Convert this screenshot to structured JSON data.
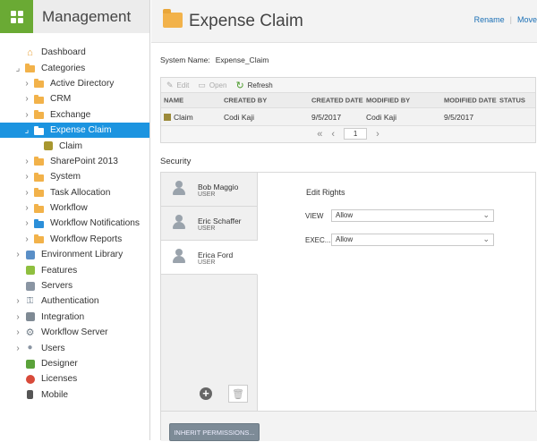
{
  "app": {
    "title": "Management"
  },
  "colors": {
    "accent": "#1c94e0",
    "brand": "#6aaa34",
    "folder": "#f2b24a"
  },
  "sidebar": {
    "items": [
      {
        "label": "Dashboard",
        "icon": "home-icon",
        "level": 0,
        "twist": ""
      },
      {
        "label": "Categories",
        "icon": "folder-icon",
        "level": 0,
        "twist": "expanded"
      },
      {
        "label": "Active Directory",
        "icon": "folder-icon",
        "level": 1,
        "twist": "collapsed"
      },
      {
        "label": "CRM",
        "icon": "folder-icon",
        "level": 1,
        "twist": "collapsed"
      },
      {
        "label": "Exchange",
        "icon": "folder-icon",
        "level": 1,
        "twist": "collapsed"
      },
      {
        "label": "Expense Claim",
        "icon": "folder-icon",
        "level": 1,
        "twist": "expanded",
        "selected": true
      },
      {
        "label": "Claim",
        "icon": "cube-icon",
        "level": 2,
        "twist": ""
      },
      {
        "label": "SharePoint 2013",
        "icon": "folder-icon",
        "level": 1,
        "twist": "collapsed"
      },
      {
        "label": "System",
        "icon": "folder-icon",
        "level": 1,
        "twist": "collapsed"
      },
      {
        "label": "Task Allocation",
        "icon": "folder-icon",
        "level": 1,
        "twist": "collapsed"
      },
      {
        "label": "Workflow",
        "icon": "folder-icon",
        "level": 1,
        "twist": "collapsed"
      },
      {
        "label": "Workflow Notifications",
        "icon": "folder-blue-icon",
        "level": 1,
        "twist": "collapsed"
      },
      {
        "label": "Workflow Reports",
        "icon": "folder-icon",
        "level": 1,
        "twist": "collapsed"
      },
      {
        "label": "Environment Library",
        "icon": "library-icon",
        "level": 0,
        "twist": "collapsed"
      },
      {
        "label": "Features",
        "icon": "features-icon",
        "level": 0,
        "twist": ""
      },
      {
        "label": "Servers",
        "icon": "servers-icon",
        "level": 0,
        "twist": ""
      },
      {
        "label": "Authentication",
        "icon": "key-icon",
        "level": 0,
        "twist": "collapsed"
      },
      {
        "label": "Integration",
        "icon": "puzzle-icon",
        "level": 0,
        "twist": "collapsed"
      },
      {
        "label": "Workflow Server",
        "icon": "gear-icon",
        "level": 0,
        "twist": "collapsed"
      },
      {
        "label": "Users",
        "icon": "user-icon",
        "level": 0,
        "twist": "collapsed"
      },
      {
        "label": "Designer",
        "icon": "designer-icon",
        "level": 0,
        "twist": ""
      },
      {
        "label": "Licenses",
        "icon": "license-icon",
        "level": 0,
        "twist": ""
      },
      {
        "label": "Mobile",
        "icon": "mobile-icon",
        "level": 0,
        "twist": ""
      }
    ]
  },
  "header": {
    "title": "Expense Claim",
    "rename": "Rename",
    "sep": "|",
    "move": "Move"
  },
  "system_name": {
    "label": "System Name:",
    "value": "Expense_Claim"
  },
  "toolbar": {
    "edit": "Edit",
    "open": "Open",
    "refresh": "Refresh"
  },
  "table": {
    "columns": [
      "NAME",
      "CREATED BY",
      "CREATED DATE",
      "MODIFIED BY",
      "MODIFIED DATE",
      "STATUS"
    ],
    "rows": [
      {
        "name": "Claim",
        "created_by": "Codi Kaji",
        "created_date": "9/5/2017",
        "modified_by": "Codi Kaji",
        "modified_date": "9/5/2017",
        "status": ""
      }
    ],
    "page": "1"
  },
  "security": {
    "title": "Security",
    "users": [
      {
        "name": "Bob Maggio",
        "role": "USER"
      },
      {
        "name": "Eric Schaffer",
        "role": "USER"
      },
      {
        "name": "Erica Ford",
        "role": "USER",
        "selected": true
      }
    ],
    "rights_title": "Edit Rights",
    "rights": [
      {
        "label": "VIEW",
        "value": "Allow"
      },
      {
        "label": "EXEC...",
        "value": "Allow"
      }
    ],
    "inherit_button": "INHERIT PERMISSIONS..."
  }
}
